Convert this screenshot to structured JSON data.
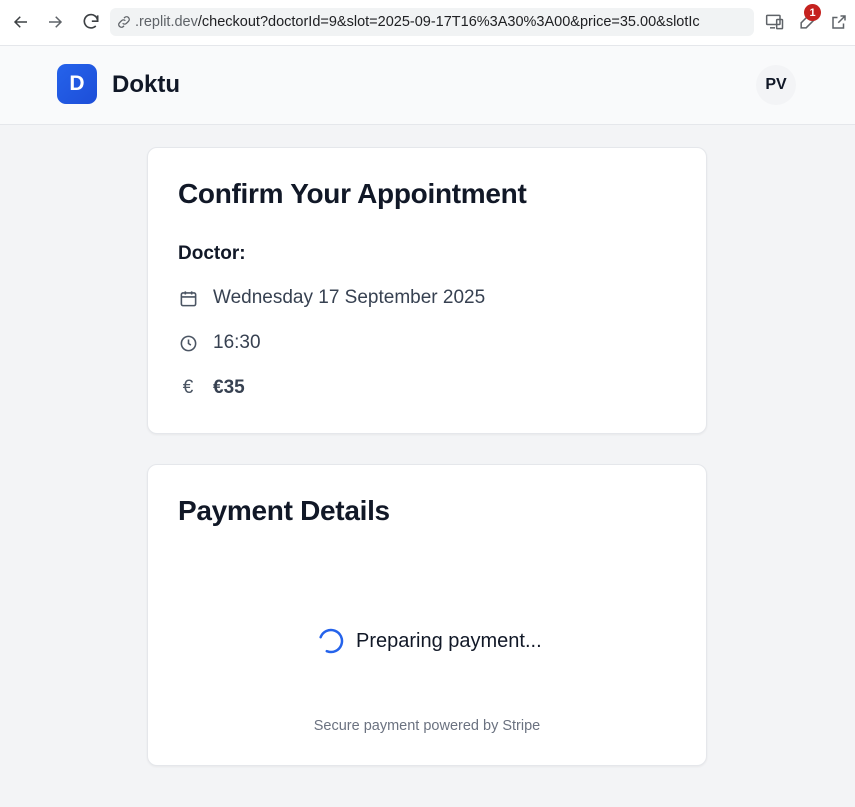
{
  "browser": {
    "url_host": ".replit.dev",
    "url_path": "/checkout?doctorId=9&slot=2025-09-17T16%3A30%3A00&price=35.00&slotIc",
    "extension_badge": "1"
  },
  "header": {
    "logo_letter": "D",
    "brand": "Doktu",
    "avatar_initials": "PV"
  },
  "appointment": {
    "title": "Confirm Your Appointment",
    "doctor_label": "Doctor:",
    "date": "Wednesday 17 September 2025",
    "time": "16:30",
    "price": "€35",
    "currency_symbol": "€"
  },
  "payment": {
    "title": "Payment Details",
    "loading_text": "Preparing payment...",
    "secure_text": "Secure payment powered by Stripe"
  },
  "colors": {
    "accent": "#2563eb",
    "background": "#f3f4f6",
    "card": "#ffffff"
  },
  "icons": [
    "back-arrow-icon",
    "forward-arrow-icon",
    "reload-icon",
    "link-icon",
    "screen-cast-icon",
    "extension-icon",
    "open-external-icon",
    "calendar-icon",
    "clock-icon",
    "euro-icon",
    "spinner-icon"
  ]
}
